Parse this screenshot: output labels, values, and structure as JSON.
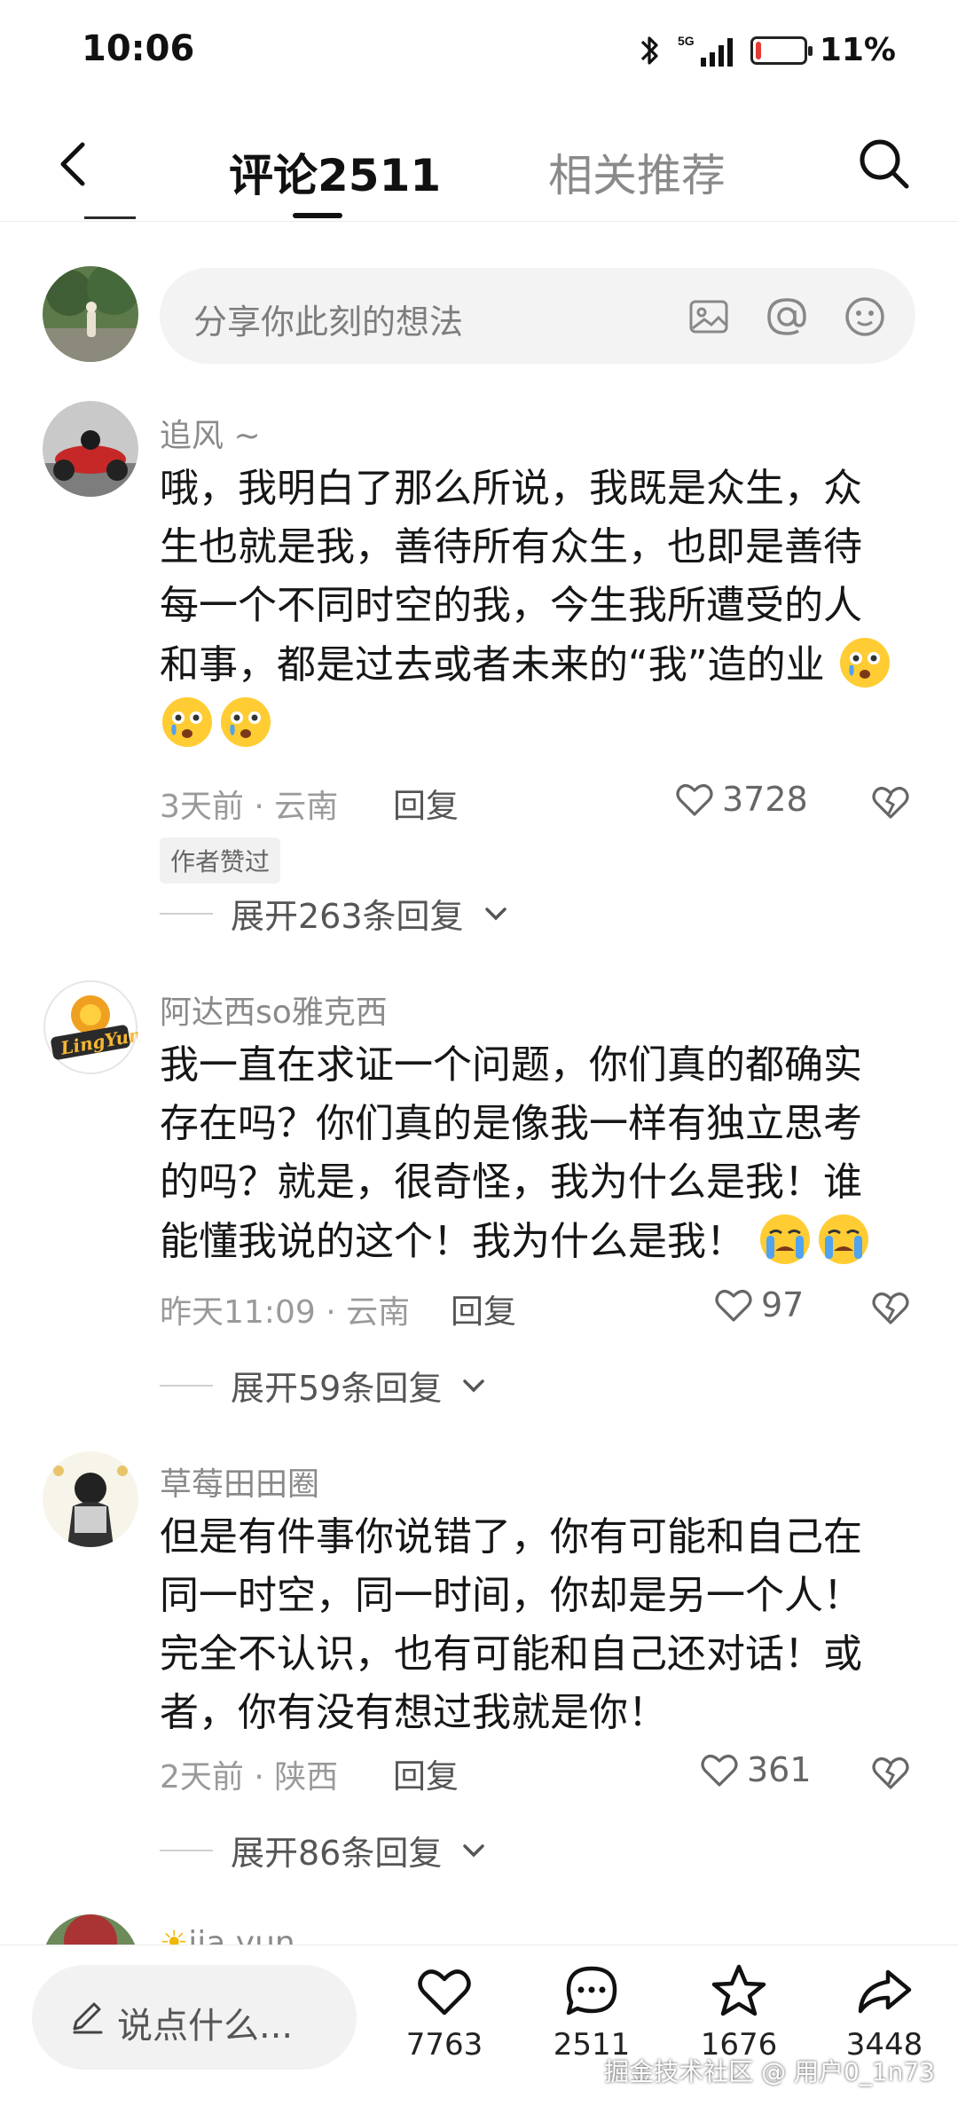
{
  "status_bar": {
    "time": "10:06",
    "network": "5G",
    "battery_percent_text": "11%",
    "battery_level": 0.11,
    "battery_color": "#e53935"
  },
  "nav": {
    "tab_comments": "评论2511",
    "tab_related": "相关推荐"
  },
  "composer": {
    "placeholder": "分享你此刻的想法"
  },
  "comments": [
    {
      "user": "追风 ~",
      "text": "哦，我明白了那么所说，我既是众生，众生也就是我，善待所有众生，也即是善待每一个不同时空的我，今生我所遭受的人和事，都是过去或者未来的“我”造的业",
      "emojis": [
        "crying-face-emoji",
        "crying-face-emoji",
        "crying-face-emoji"
      ],
      "meta": "3天前 · 云南",
      "reply_label": "回复",
      "likes": "3728",
      "badge": "作者赞过",
      "expand_label": "展开263条回复"
    },
    {
      "user": "阿达西so雅克西",
      "text": "我一直在求证一个问题，你们真的都确实存在吗？你们真的是像我一样有独立思考的吗？就是，很奇怪，我为什么是我！谁能懂我说的这个！我为什么是我！",
      "emojis": [
        "sobbing-face-emoji",
        "sobbing-face-emoji"
      ],
      "meta": "昨天11:09 · 云南",
      "reply_label": "回复",
      "likes": "97",
      "expand_label": "展开59条回复"
    },
    {
      "user": "草莓田田圈",
      "text": "但是有件事你说错了，你有可能和自己在同一时空，同一时间，你却是另一个人！完全不认识，也有可能和自己还对话！或者，你有没有想过我就是你！",
      "meta": "2天前 · 陕西",
      "reply_label": "回复",
      "likes": "361",
      "expand_label": "展开86条回复"
    }
  ],
  "peek_comment": {
    "user": "jia yun"
  },
  "bottom_bar": {
    "say_placeholder": "说点什么...",
    "like_count": "7763",
    "comment_count": "2511",
    "favorite_count": "1676",
    "share_count": "3448"
  },
  "watermark": "掘金技术社区 @ 用户0_1n73"
}
